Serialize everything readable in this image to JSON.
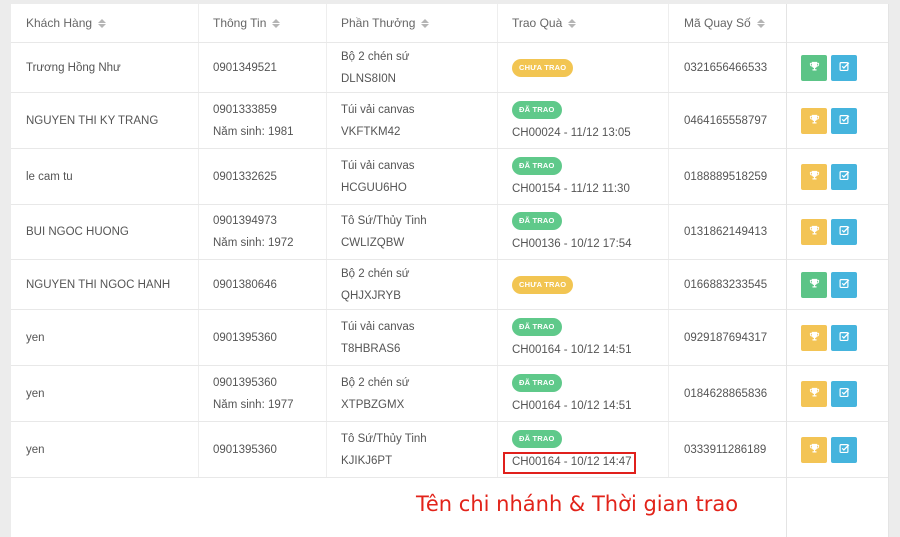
{
  "headers": {
    "customer": "Khách Hàng",
    "info": "Thông Tin",
    "prize": "Phần Thưởng",
    "award": "Trao Quà",
    "code": "Mã Quay Số"
  },
  "status_labels": {
    "pending": "CHƯA TRAO",
    "done": "ĐÃ TRAO"
  },
  "colors": {
    "pending": "#f2c552",
    "done": "#5fc98a",
    "award_button_active": "#5cc487",
    "award_button_disabled": "#f3c455",
    "edit_button": "#45b4dd",
    "annotation": "#e2231a"
  },
  "icons": {
    "award": "trophy-icon",
    "edit": "edit-check-icon"
  },
  "rows": [
    {
      "name": "Trương Hồng Như",
      "phone": "0901349521",
      "birth": "",
      "prize": "Bộ 2 chén sứ",
      "prize_code": "DLNS8I0N",
      "status": "CHƯA TRAO",
      "awarded": "",
      "code": "0321656466533"
    },
    {
      "name": "NGUYEN THI KY TRANG",
      "phone": "0901333859",
      "birth": "Năm sinh: 1981",
      "prize": "Túi vải canvas",
      "prize_code": "VKFTKM42",
      "status": "ĐÃ TRAO",
      "awarded": "CH00024 - 11/12 13:05",
      "code": "0464165558797"
    },
    {
      "name": "le cam tu",
      "phone": "0901332625",
      "birth": "",
      "prize": "Túi vải canvas",
      "prize_code": "HCGUU6HO",
      "status": "ĐÃ TRAO",
      "awarded": "CH00154 - 11/12 11:30",
      "code": "0188889518259"
    },
    {
      "name": "BUI NGOC HUONG",
      "phone": "0901394973",
      "birth": "Năm sinh: 1972",
      "prize": "Tô Sứ/Thủy Tinh",
      "prize_code": "CWLIZQBW",
      "status": "ĐÃ TRAO",
      "awarded": "CH00136 - 10/12 17:54",
      "code": "0131862149413"
    },
    {
      "name": "NGUYEN THI NGOC HANH",
      "phone": "0901380646",
      "birth": "",
      "prize": "Bộ 2 chén sứ",
      "prize_code": "QHJXJRYB",
      "status": "CHƯA TRAO",
      "awarded": "",
      "code": "0166883233545"
    },
    {
      "name": "yen",
      "phone": "0901395360",
      "birth": "",
      "prize": "Túi vải canvas",
      "prize_code": "T8HBRAS6",
      "status": "ĐÃ TRAO",
      "awarded": "CH00164 - 10/12 14:51",
      "code": "0929187694317"
    },
    {
      "name": "yen",
      "phone": "0901395360",
      "birth": "Năm sinh: 1977",
      "prize": "Bộ 2 chén sứ",
      "prize_code": "XTPBZGMX",
      "status": "ĐÃ TRAO",
      "awarded": "CH00164 - 10/12 14:51",
      "code": "0184628865836"
    },
    {
      "name": "yen",
      "phone": "0901395360",
      "birth": "",
      "prize": "Tô Sứ/Thủy Tinh",
      "prize_code": "KJIKJ6PT",
      "status": "ĐÃ TRAO",
      "awarded": "CH00164 - 10/12 14:47",
      "code": "0333911286189"
    }
  ],
  "annotation": "Tên chi nhánh & Thời gian trao"
}
